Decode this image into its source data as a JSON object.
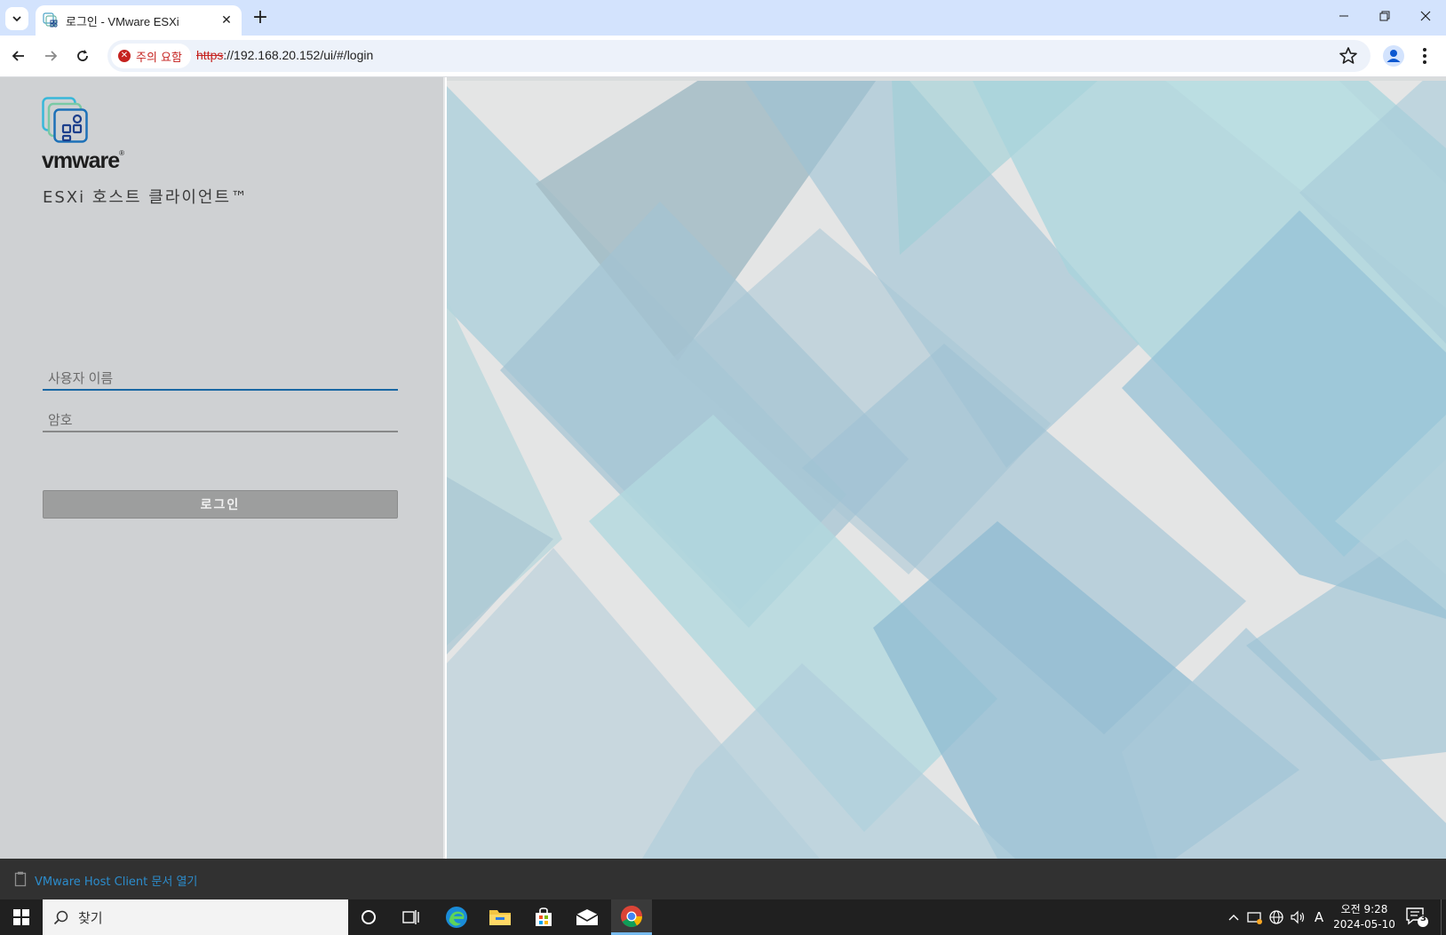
{
  "browser": {
    "tab": {
      "title": "로그인 - VMware ESXi"
    },
    "url": {
      "scheme": "https",
      "rest": "://192.168.20.152/ui/#/login"
    },
    "security_warning": "주의 요함"
  },
  "login": {
    "brand": "vmware",
    "product_name": "ESXi 호스트 클라이언트™",
    "username_placeholder": "사용자 이름",
    "password_placeholder": "암호",
    "login_button": "로그인"
  },
  "footer": {
    "doc_link": "VMware Host Client 문서 열기"
  },
  "taskbar": {
    "search_placeholder": "찾기",
    "time": "오전 9:28",
    "date": "2024-05-10",
    "notification_count": "3",
    "input_indicator": "A"
  },
  "colors": {
    "accent": "#1a67a3",
    "warning": "#c5221f",
    "link": "#2c8ccc"
  },
  "icons": [
    "tab-list-icon",
    "vmware-favicon",
    "close-icon",
    "plus-icon",
    "minimize-icon",
    "restore-icon",
    "back-icon",
    "forward-icon",
    "reload-icon",
    "warning-icon",
    "star-icon",
    "profile-icon",
    "menu-icon",
    "vmware-logo-icon",
    "document-icon",
    "windows-start-icon",
    "search-icon",
    "cortana-icon",
    "task-view-icon",
    "edge-icon",
    "file-explorer-icon",
    "store-icon",
    "mail-icon",
    "chrome-icon",
    "chevron-up-icon",
    "network-status-icon",
    "globe-icon",
    "volume-icon",
    "notification-icon"
  ]
}
